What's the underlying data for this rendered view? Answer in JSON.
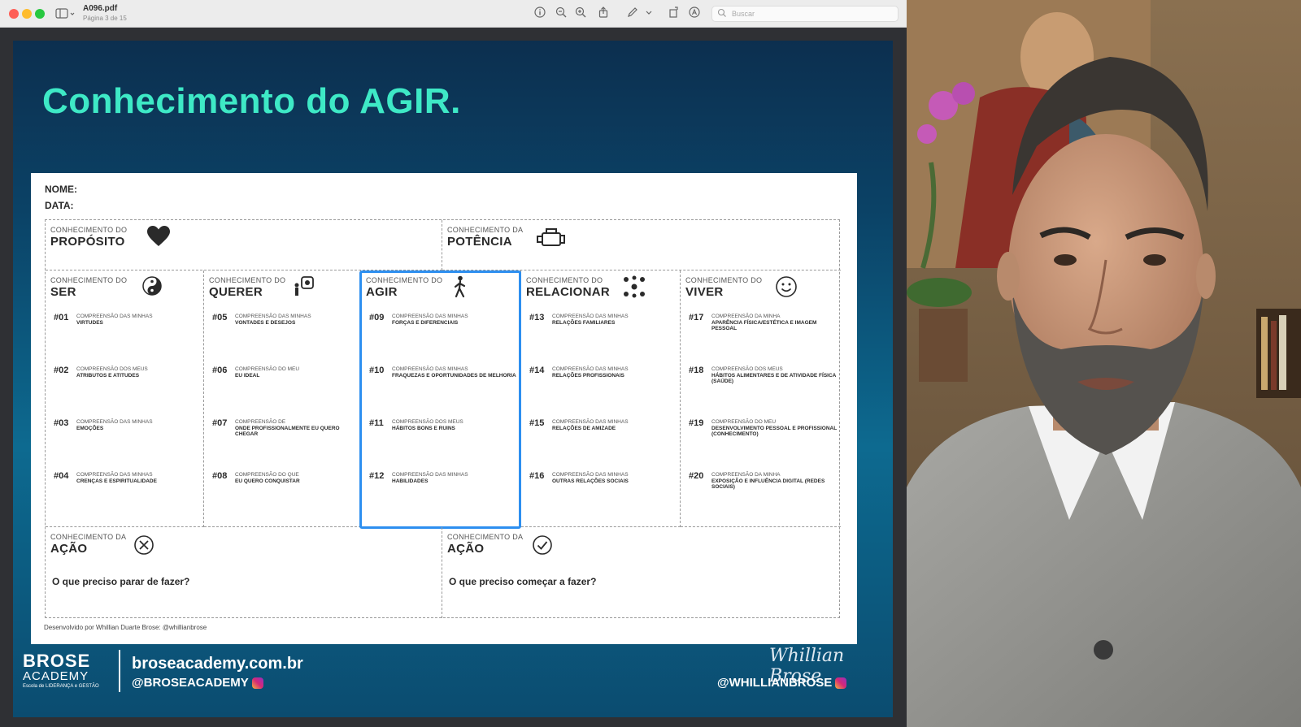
{
  "window": {
    "doc_title": "A096.pdf",
    "doc_subtitle": "Página 3 de 15",
    "search_placeholder": "Buscar"
  },
  "slide": {
    "title": "Conhecimento do AGIR.",
    "name_label": "NOME:",
    "date_label": "DATA:",
    "top_cells": [
      {
        "small": "CONHECIMENTO DO",
        "big": "PROPÓSITO",
        "icon": "heart-icon"
      },
      {
        "small": "CONHECIMENTO DA",
        "big": "POTÊNCIA",
        "icon": "engine-icon"
      }
    ],
    "columns": [
      {
        "small": "CONHECIMENTO DO",
        "big": "SER",
        "icon": "yin-yang-icon",
        "items": [
          {
            "num": "#01",
            "pre": "COMPREENSÃO DAS MINHAS",
            "txt": "VIRTUDES"
          },
          {
            "num": "#02",
            "pre": "COMPREENSÃO DOS MEUS",
            "txt": "ATRIBUTOS E ATITUDES"
          },
          {
            "num": "#03",
            "pre": "COMPREENSÃO DAS MINHAS",
            "txt": "EMOÇÕES"
          },
          {
            "num": "#04",
            "pre": "COMPREENSÃO DAS MINHAS",
            "txt": "CRENÇAS E ESPIRITUALIDADE"
          }
        ]
      },
      {
        "small": "CONHECIMENTO DO",
        "big": "QUERER",
        "icon": "person-goal-icon",
        "items": [
          {
            "num": "#05",
            "pre": "COMPREENSÃO DAS MINHAS",
            "txt": "VONTADES E DESEJOS"
          },
          {
            "num": "#06",
            "pre": "COMPREENSÃO DO MEU",
            "txt": "EU IDEAL"
          },
          {
            "num": "#07",
            "pre": "COMPREENSÃO DE",
            "txt": "ONDE PROFISSIONALMENTE EU QUERO CHEGAR"
          },
          {
            "num": "#08",
            "pre": "COMPREENSÃO DO QUE",
            "txt": "EU QUERO CONQUISTAR"
          }
        ]
      },
      {
        "small": "CONHECIMENTO DO",
        "big": "AGIR",
        "icon": "walking-icon",
        "items": [
          {
            "num": "#09",
            "pre": "COMPREENSÃO DAS MINHAS",
            "txt": "FORÇAS E DIFERENCIAIS"
          },
          {
            "num": "#10",
            "pre": "COMPREENSÃO DAS MINHAS",
            "txt": "FRAQUEZAS E OPORTUNIDADES DE MELHORIA"
          },
          {
            "num": "#11",
            "pre": "COMPREENSÃO DOS MEUS",
            "txt": "HÁBITOS BONS E RUINS"
          },
          {
            "num": "#12",
            "pre": "COMPREENSÃO DAS MINHAS",
            "txt": "HABILIDADES"
          }
        ]
      },
      {
        "small": "CONHECIMENTO DO",
        "big": "RELACIONAR",
        "icon": "network-icon",
        "items": [
          {
            "num": "#13",
            "pre": "COMPREENSÃO DAS MINHAS",
            "txt": "RELAÇÕES FAMILIARES"
          },
          {
            "num": "#14",
            "pre": "COMPREENSÃO DAS MINHAS",
            "txt": "RELAÇÕES PROFISSIONAIS"
          },
          {
            "num": "#15",
            "pre": "COMPREENSÃO DAS MINHAS",
            "txt": "RELAÇÕES DE AMIZADE"
          },
          {
            "num": "#16",
            "pre": "COMPREENSÃO DAS MINHAS",
            "txt": "OUTRAS RELAÇÕES SOCIAIS"
          }
        ]
      },
      {
        "small": "CONHECIMENTO DO",
        "big": "VIVER",
        "icon": "smiley-icon",
        "items": [
          {
            "num": "#17",
            "pre": "COMPREENSÃO DA MINHA",
            "txt": "APARÊNCIA FÍSICA/ESTÉTICA E IMAGEM PESSOAL"
          },
          {
            "num": "#18",
            "pre": "COMPREENSÃO DOS MEUS",
            "txt": "HÁBITOS ALIMENTARES E DE ATIVIDADE FÍSICA (SAÚDE)"
          },
          {
            "num": "#19",
            "pre": "COMPREENSÃO DO MEU",
            "txt": "DESENVOLVIMENTO PESSOAL E PROFISSIONAL (CONHECIMENTO)"
          },
          {
            "num": "#20",
            "pre": "COMPREENSÃO DA MINHA",
            "txt": "EXPOSIÇÃO E INFLUÊNCIA DIGITAL (REDES SOCIAIS)"
          }
        ]
      }
    ],
    "bottom_cells": [
      {
        "small": "CONHECIMENTO DA",
        "big": "AÇÃO",
        "icon": "x-circle-icon",
        "question": "O que preciso parar de fazer?"
      },
      {
        "small": "CONHECIMENTO DA",
        "big": "AÇÃO",
        "icon": "check-circle-icon",
        "question": "O que preciso começar a fazer?"
      }
    ],
    "credit": "Desenvolvido por Whillian Duarte Brose: @whillianbrose",
    "footer": {
      "logo_line1": "BROSE",
      "logo_line2": "ACADEMY",
      "logo_tag": "Escola de LIDERANÇA e GESTÃO",
      "site": "broseacademy.com.br",
      "handle": "@BROSEACADEMY",
      "signature": "Whillian Brose",
      "handle2": "@WHILLIANBROSE"
    },
    "highlight_color": "#2d8ff0",
    "title_color": "#3ee9c6"
  }
}
